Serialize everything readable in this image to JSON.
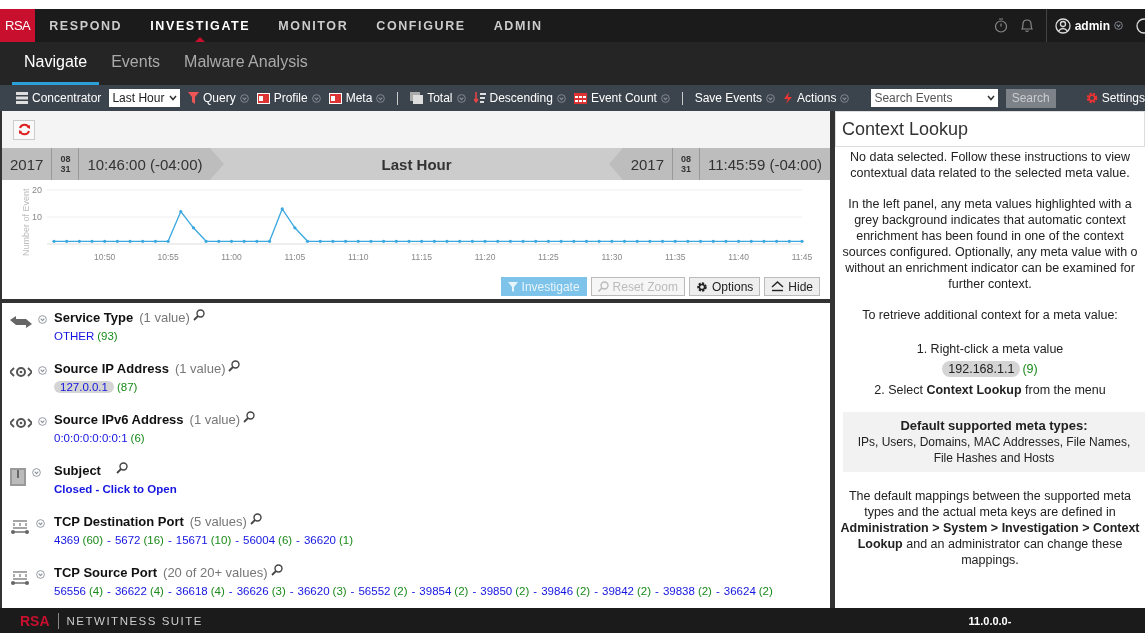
{
  "top_nav": {
    "logo": "RSA",
    "items": [
      {
        "label": "RESPOND",
        "selected": false
      },
      {
        "label": "INVESTIGATE",
        "selected": true
      },
      {
        "label": "MONITOR",
        "selected": false
      },
      {
        "label": "CONFIGURE",
        "selected": false
      },
      {
        "label": "ADMIN",
        "selected": false
      }
    ],
    "user": "admin"
  },
  "sub_tabs": [
    {
      "label": "Navigate",
      "selected": true
    },
    {
      "label": "Events",
      "selected": false
    },
    {
      "label": "Malware Analysis",
      "selected": false
    }
  ],
  "toolbar": [
    {
      "kind": "button",
      "label": "Concentrator"
    },
    {
      "kind": "select",
      "label": "Last Hour"
    },
    {
      "kind": "menu",
      "label": "Query"
    },
    {
      "kind": "menu",
      "label": "Profile"
    },
    {
      "kind": "menu",
      "label": "Meta"
    },
    {
      "kind": "separator"
    },
    {
      "kind": "menu",
      "label": "Total"
    },
    {
      "kind": "menu",
      "label": "Descending"
    },
    {
      "kind": "menu",
      "label": "Event Count"
    },
    {
      "kind": "separator"
    },
    {
      "kind": "menu",
      "label": "Save Events"
    },
    {
      "kind": "menu",
      "label": "Actions"
    }
  ],
  "search": {
    "placeholder": "Search Events",
    "button": "Search",
    "button_disabled": true
  },
  "settings": "Settings",
  "time_range": {
    "start": {
      "year": "2017",
      "month": "08",
      "day": "31",
      "time": "10:46:00 (-04:00)"
    },
    "label": "Last Hour",
    "end": {
      "year": "2017",
      "month": "08",
      "day": "31",
      "time": "11:45:59 (-04:00)"
    }
  },
  "chart_data": {
    "type": "line",
    "ylabel": "Number of Event",
    "categories": [
      null,
      null,
      null,
      null,
      "10:50",
      null,
      null,
      null,
      null,
      "10:55",
      null,
      null,
      null,
      null,
      "11:00",
      null,
      null,
      null,
      null,
      "11:05",
      null,
      null,
      null,
      null,
      "11:10",
      null,
      null,
      null,
      null,
      "11:15",
      null,
      null,
      null,
      null,
      "11:20",
      null,
      null,
      null,
      null,
      "11:25",
      null,
      null,
      null,
      null,
      "11:30",
      null,
      null,
      null,
      null,
      "11:35",
      null,
      null,
      null,
      null,
      "11:40",
      null,
      null,
      null,
      null,
      "11:45"
    ],
    "series": [
      {
        "color": "#3aa8e0",
        "values": [
          1,
          1,
          1,
          1,
          1,
          1,
          1,
          1,
          1,
          1,
          12,
          6,
          1,
          1,
          1,
          1,
          1,
          1,
          13,
          6,
          1,
          1,
          1,
          1,
          1,
          1,
          1,
          1,
          1,
          1,
          1,
          1,
          1,
          1,
          1,
          1,
          1,
          1,
          1,
          1,
          1,
          1,
          1,
          1,
          1,
          1,
          1,
          1,
          1,
          1,
          1,
          1,
          1,
          1,
          1,
          1,
          1,
          1,
          1,
          1
        ]
      }
    ],
    "ylim": [
      0,
      20
    ],
    "yticks": [
      10,
      20
    ]
  },
  "chart_buttons": [
    {
      "label": "Investigate",
      "kind": "investigate",
      "disabled": true
    },
    {
      "label": "Reset Zoom",
      "kind": "zoom",
      "disabled": true
    },
    {
      "label": "Options",
      "kind": "options",
      "disabled": false
    },
    {
      "label": "Hide",
      "kind": "hide",
      "disabled": false
    }
  ],
  "meta_groups": [
    {
      "name": "Service Type",
      "summary": "(1 value)",
      "values": [
        {
          "value": "OTHER",
          "count": "(93)",
          "highlighted": false
        }
      ]
    },
    {
      "name": "Source IP Address",
      "summary": "(1 value)",
      "values": [
        {
          "value": "127.0.0.1",
          "count": "(87)",
          "highlighted": true
        }
      ]
    },
    {
      "name": "Source IPv6 Address",
      "summary": "(1 value)",
      "values": [
        {
          "value": "0:0:0:0:0:0:0:1",
          "count": "(6)",
          "highlighted": false
        }
      ]
    },
    {
      "name": "Subject",
      "closed_link": "Closed - Click to Open"
    },
    {
      "name": "TCP Destination Port",
      "summary": "(5 values)",
      "separator": "-",
      "values": [
        {
          "value": "4369",
          "count": "(60)",
          "highlighted": false
        },
        {
          "value": "5672",
          "count": "(16)",
          "highlighted": false
        },
        {
          "value": "15671",
          "count": "(10)",
          "highlighted": false
        },
        {
          "value": "56004",
          "count": "(6)",
          "highlighted": false
        },
        {
          "value": "36620",
          "count": "(1)",
          "highlighted": false
        }
      ]
    },
    {
      "name": "TCP Source Port",
      "summary": "(20 of 20+ values)",
      "separator": "-",
      "values": [
        {
          "value": "56556",
          "count": "(4)",
          "highlighted": false
        },
        {
          "value": "36622",
          "count": "(4)",
          "highlighted": false
        },
        {
          "value": "36618",
          "count": "(4)",
          "highlighted": false
        },
        {
          "value": "36626",
          "count": "(3)",
          "highlighted": false
        },
        {
          "value": "36620",
          "count": "(3)",
          "highlighted": false
        },
        {
          "value": "56552",
          "count": "(2)",
          "highlighted": false
        },
        {
          "value": "39854",
          "count": "(2)",
          "highlighted": false
        },
        {
          "value": "39850",
          "count": "(2)",
          "highlighted": false
        },
        {
          "value": "39846",
          "count": "(2)",
          "highlighted": false
        },
        {
          "value": "39842",
          "count": "(2)",
          "highlighted": false
        },
        {
          "value": "39838",
          "count": "(2)",
          "highlighted": false
        },
        {
          "value": "36624",
          "count": "(2)",
          "highlighted": false
        }
      ]
    }
  ],
  "context": {
    "title": "Context Lookup",
    "intro": [
      "No data selected. Follow these instructions to view",
      "contextual data related to the selected meta value."
    ],
    "explanation": [
      "In the left panel, any meta values highlighted with a",
      "grey background indicates that automatic context",
      "enrichment has been found in one of the context",
      "sources configured. Optionally, any meta value with o",
      "without an enrichment indicator can be examined for",
      "further context."
    ],
    "retrieve": "To retrieve additional context for a meta value:",
    "step1": "1. Right-click a meta value",
    "example": {
      "value": "192.168.1.1",
      "count": "(9)"
    },
    "step2": "2. Select **Context Lookup** from the menu",
    "types_title": "Default supported meta types:",
    "types": [
      "IPs, Users, Domains, MAC Addresses, File Names,",
      "File Hashes and Hosts"
    ],
    "mappings": [
      "The default mappings between the supported meta",
      "types and the actual meta keys are defined in",
      "**Administration > System > Investigation > Context**",
      "**Lookup** and an administrator can change these",
      "mappings."
    ]
  },
  "footer": {
    "logo": "RSA",
    "product": "NETWITNESS SUITE",
    "version": "11.0.0.0-"
  }
}
